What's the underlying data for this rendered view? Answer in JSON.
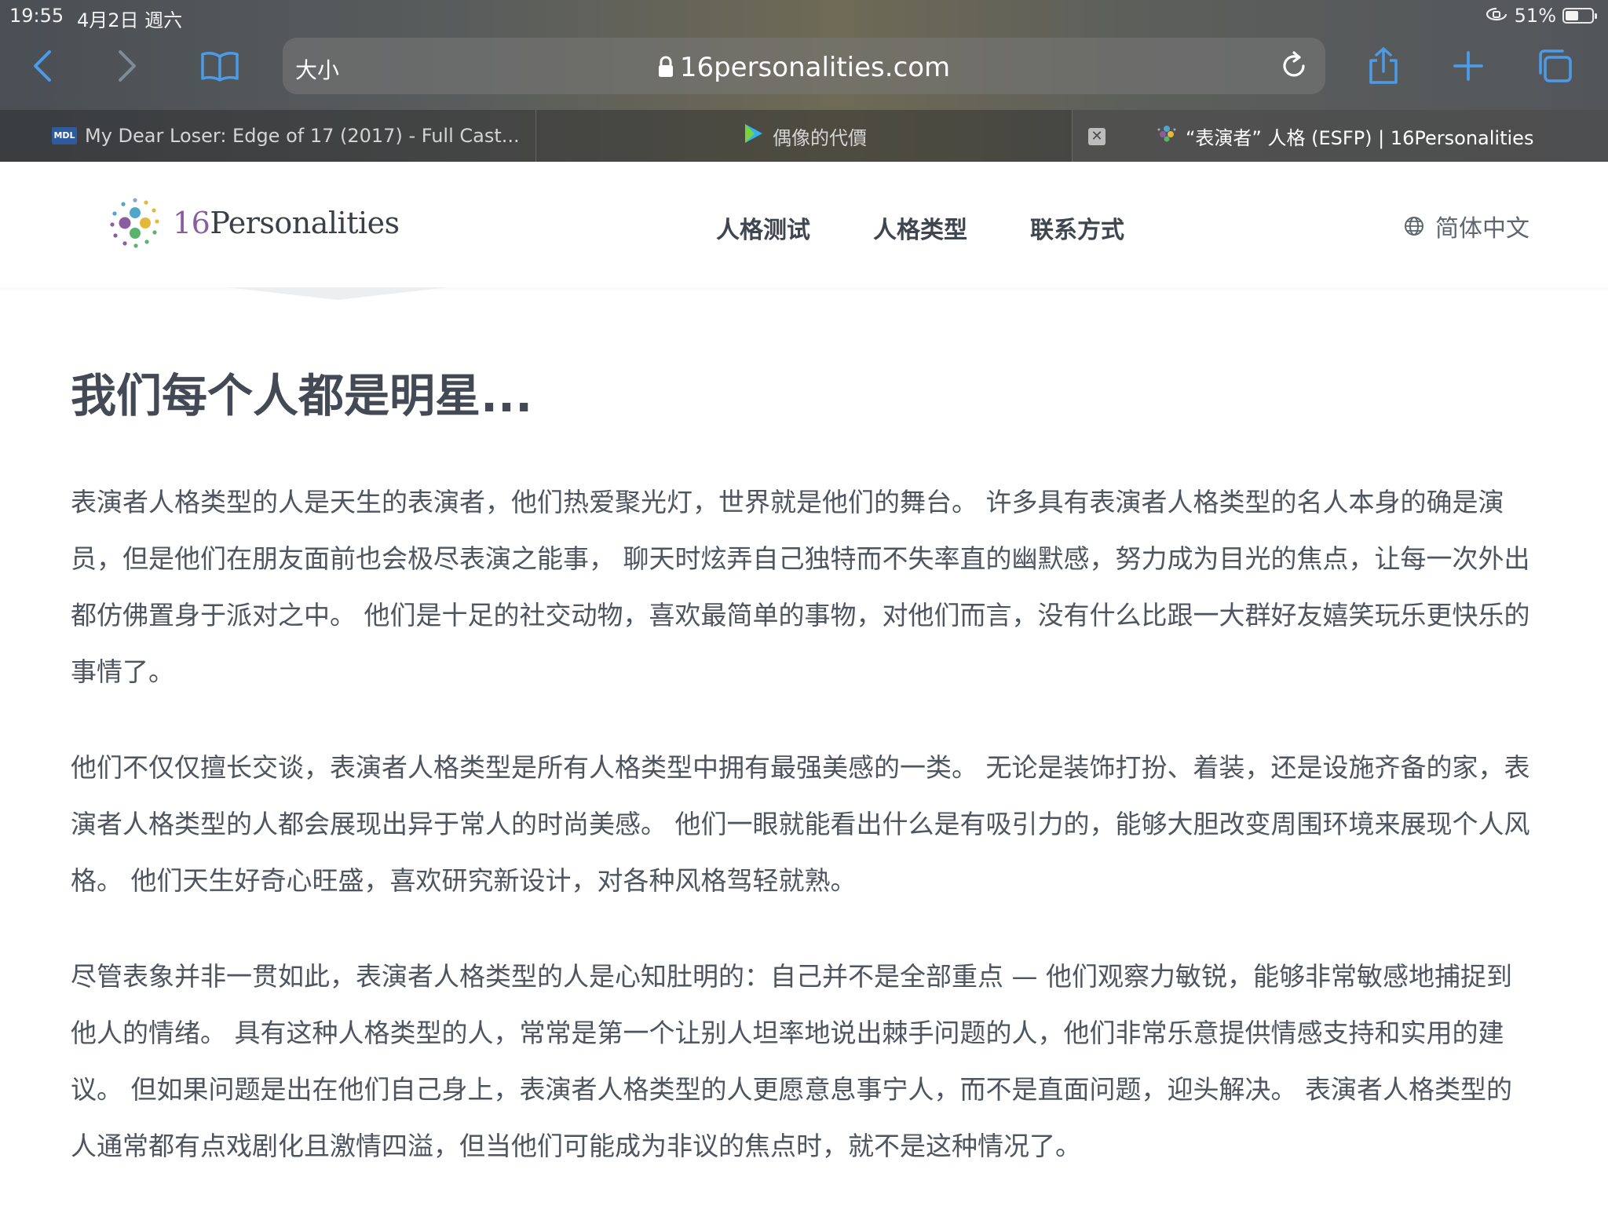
{
  "status_bar": {
    "time": "19:55",
    "date": "4月2日 週六",
    "battery": "51%",
    "battery_level": 0.51
  },
  "browser": {
    "reader_size_label": "大小",
    "url": "16personalities.com",
    "tabs": [
      {
        "title": "My Dear Loser: Edge of 17 (2017) - Full Cast...",
        "favicon": "MDL",
        "active": false
      },
      {
        "title": "偶像的代價",
        "favicon": "play-icon",
        "active": false
      },
      {
        "title": "“表演者” 人格 (ESFP) | 16Personalities",
        "favicon": "16p-logo-icon",
        "active": true
      }
    ]
  },
  "site": {
    "logo_num": "16",
    "logo_word": "Personalities",
    "nav": {
      "test": "人格测试",
      "types": "人格类型",
      "contact": "联系方式"
    },
    "language": "简体中文"
  },
  "article": {
    "title": "我们每个人都是明星...",
    "paragraphs": [
      "表演者人格类型的人是天生的表演者，他们热爱聚光灯，世界就是他们的舞台。 许多具有表演者人格类型的名人本身的确是演员，但是他们在朋友面前也会极尽表演之能事， 聊天时炫弄自己独特而不失率直的幽默感，努力成为目光的焦点，让每一次外出都仿佛置身于派对之中。 他们是十足的社交动物，喜欢最简单的事物，对他们而言，没有什么比跟一大群好友嬉笑玩乐更快乐的事情了。",
      "他们不仅仅擅长交谈，表演者人格类型是所有人格类型中拥有最强美感的一类。 无论是装饰打扮、着装，还是设施齐备的家，表演者人格类型的人都会展现出异于常人的时尚美感。 他们一眼就能看出什么是有吸引力的，能够大胆改变周围环境来展现个人风格。 他们天生好奇心旺盛，喜欢研究新设计，对各种风格驾轻就熟。",
      "尽管表象并非一贯如此，表演者人格类型的人是心知肚明的：自己并不是全部重点 — 他们观察力敏锐，能够非常敏感地捕捉到他人的情绪。 具有这种人格类型的人，常常是第一个让别人坦率地说出棘手问题的人，他们非常乐意提供情感支持和实用的建议。 但如果问题是出在他们自己身上，表演者人格类型的人更愿意息事宁人，而不是直面问题，迎头解决。 表演者人格类型的人通常都有点戏剧化且激情四溢，但当他们可能成为非议的焦点时，就不是这种情况了。"
    ]
  },
  "colors": {
    "accent_blue": "#4c9be8",
    "logo_purple": "#8a5d9e",
    "text": "#4e5560"
  }
}
